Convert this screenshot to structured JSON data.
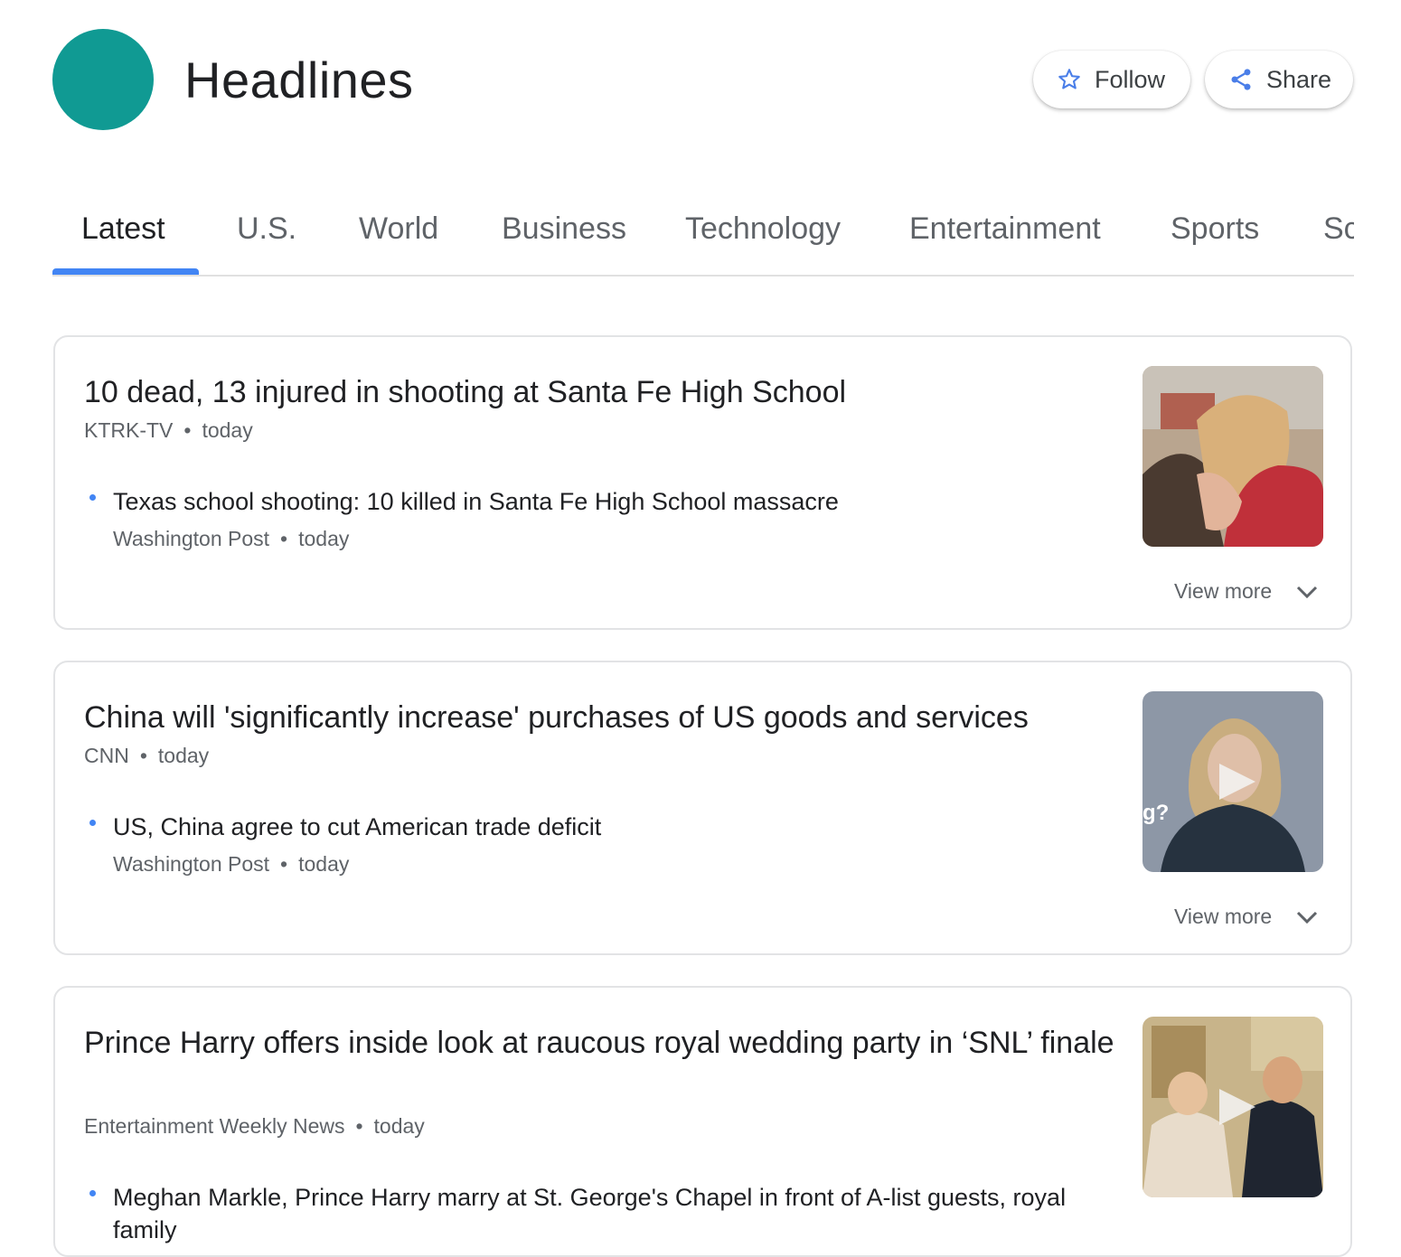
{
  "header": {
    "title": "Headlines",
    "logo_color": "#109a93",
    "follow_label": "Follow",
    "follow_icon": "star-outline-icon",
    "share_label": "Share",
    "share_icon": "share-icon"
  },
  "tabs": [
    {
      "label": "Latest",
      "active": true
    },
    {
      "label": "U.S."
    },
    {
      "label": "World"
    },
    {
      "label": "Business"
    },
    {
      "label": "Technology"
    },
    {
      "label": "Entertainment"
    },
    {
      "label": "Sports"
    },
    {
      "label": "Sc"
    }
  ],
  "accent_color": "#4285f4",
  "stories": [
    {
      "headline": "10 dead, 13 injured in shooting at Santa Fe High School",
      "source": "KTRK-TV",
      "time": "today",
      "related": {
        "title": "Texas school shooting: 10 killed in Santa Fe High School massacre",
        "source": "Washington Post",
        "time": "today"
      },
      "thumbnail": "photo of two people embracing",
      "view_more": "View more"
    },
    {
      "headline": "China will 'significantly increase' purchases of US goods and services",
      "source": "CNN",
      "time": "today",
      "related": {
        "title": "US, China agree to cut American trade deficit",
        "source": "Washington Post",
        "time": "today"
      },
      "thumbnail": "video of news anchor",
      "thumbnail_overlay_text": "g?",
      "view_more": "View more"
    },
    {
      "headline": "Prince Harry offers inside look at raucous royal wedding party in ‘SNL’ finale",
      "source": "Entertainment Weekly News",
      "time": "today",
      "related": {
        "title": "Meghan Markle, Prince Harry marry at St. George's Chapel in front of A-list guests, royal family",
        "source": "",
        "time": ""
      },
      "thumbnail": "video still of SNL sketch"
    }
  ]
}
